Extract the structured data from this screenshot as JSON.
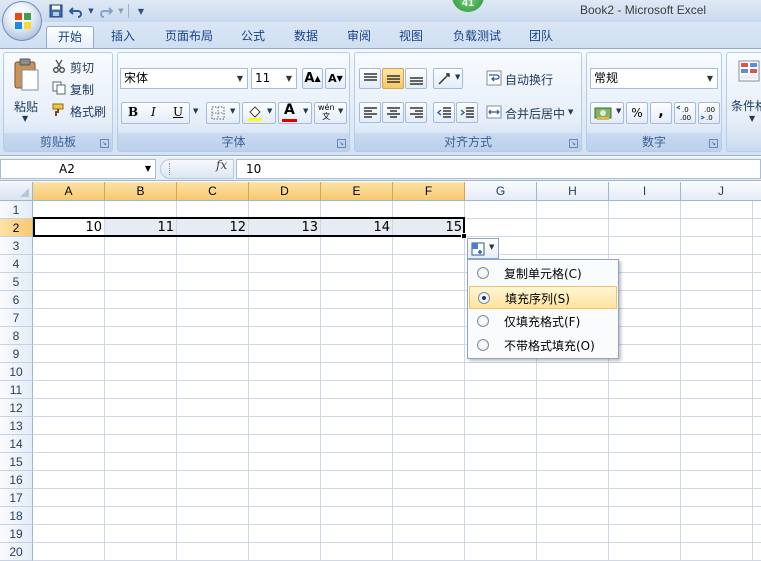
{
  "window": {
    "title": "Book2 - Microsoft Excel",
    "badge": "41"
  },
  "tabs": [
    {
      "label": "开始",
      "active": true
    },
    {
      "label": "插入"
    },
    {
      "label": "页面布局"
    },
    {
      "label": "公式"
    },
    {
      "label": "数据"
    },
    {
      "label": "审阅"
    },
    {
      "label": "视图"
    },
    {
      "label": "负载测试"
    },
    {
      "label": "团队"
    }
  ],
  "ribbon": {
    "clipboard": {
      "label": "剪贴板",
      "paste": "粘贴",
      "cut": "剪切",
      "copy": "复制",
      "format_painter": "格式刷"
    },
    "font": {
      "label": "字体",
      "font_name": "宋体",
      "font_size": "11",
      "bold": "B",
      "italic": "I",
      "underline": "U",
      "phonetic": "wén\n文"
    },
    "alignment": {
      "label": "对齐方式",
      "wrap_text": "自动换行",
      "merge_center": "合并后居中"
    },
    "number": {
      "label": "数字",
      "format": "常规",
      "percent": "%",
      "comma": ","
    },
    "styles": {
      "conditional": "条件格"
    }
  },
  "formula_bar": {
    "name_box": "A2",
    "fx": "fx",
    "value": "10"
  },
  "grid": {
    "columns": [
      "A",
      "B",
      "C",
      "D",
      "E",
      "F",
      "G",
      "H",
      "I",
      "J"
    ],
    "rows": [
      "1",
      "2",
      "3",
      "4",
      "5",
      "6",
      "7",
      "8",
      "9",
      "10",
      "11",
      "12",
      "13",
      "14",
      "15",
      "16",
      "17",
      "18",
      "19",
      "20"
    ],
    "row2_values": [
      "10",
      "11",
      "12",
      "13",
      "14",
      "15"
    ]
  },
  "autofill_menu": {
    "items": [
      {
        "label": "复制单元格(C)"
      },
      {
        "label": "填充序列(S)",
        "selected": true
      },
      {
        "label": "仅填充格式(F)"
      },
      {
        "label": "不带格式填充(O)"
      }
    ]
  }
}
